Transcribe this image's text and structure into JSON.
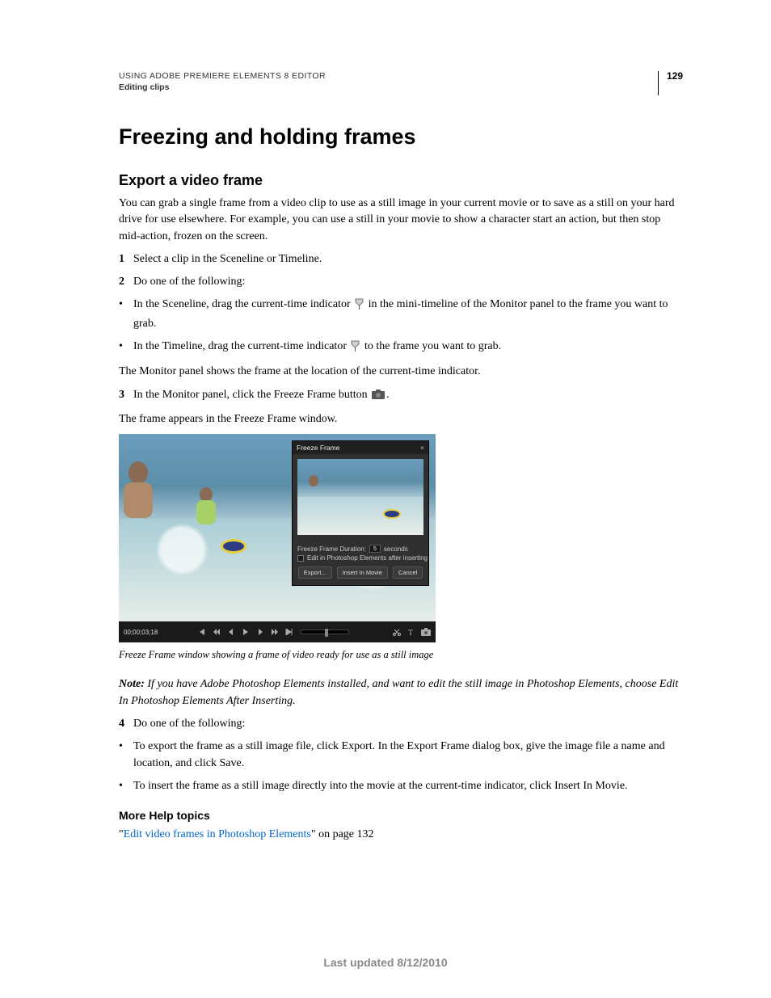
{
  "header": {
    "doc_title": "USING ADOBE PREMIERE ELEMENTS 8 EDITOR",
    "section": "Editing clips",
    "page_number": "129"
  },
  "h1": "Freezing and holding frames",
  "h2": "Export a video frame",
  "intro": "You can grab a single frame from a video clip to use as a still image in your current movie or to save as a still on your hard drive for use elsewhere. For example, you can use a still in your movie to show a character start an action, but then stop mid-action, frozen on the screen.",
  "steps": {
    "s1": "Select a clip in the Sceneline or Timeline.",
    "s2": "Do one of the following:",
    "s2a_pre": "In the Sceneline, drag the current-time indicator",
    "s2a_post": "in the mini-timeline of the Monitor panel to the frame you want to grab.",
    "s2b_pre": "In the Timeline, drag the current-time indicator",
    "s2b_post": "to the frame you want to grab.",
    "after2": "The Monitor panel shows the frame at the location of the current-time indicator.",
    "s3_pre": "In the Monitor panel, click the Freeze Frame button",
    "s3_post": ".",
    "after3": "The frame appears in the Freeze Frame window.",
    "s4": "Do one of the following:",
    "s4a": "To export the frame as a still image file, click Export. In the Export Frame dialog box, give the image file a name and location, and click Save.",
    "s4b": "To insert the frame as a still image directly into the movie at the current-time indicator, click Insert In Movie."
  },
  "screenshot": {
    "dialog_title": "Freeze Frame",
    "duration_label": "Freeze Frame Duration:",
    "duration_value": "5",
    "duration_unit": "seconds",
    "edit_label": "Edit in Photoshop Elements after inserting",
    "btn_export": "Export...",
    "btn_insert": "Insert In Movie",
    "btn_cancel": "Cancel",
    "timecode": "00;00;03;18"
  },
  "caption": "Freeze Frame window showing a frame of video ready for use as a still image",
  "note": {
    "label": "Note:",
    "text": "If you have Adobe Photoshop Elements installed, and want to edit the still image in Photoshop Elements, choose Edit In Photoshop Elements After Inserting."
  },
  "more_help": {
    "heading": "More Help topics",
    "link_text": "Edit video frames in Photoshop Elements",
    "link_suffix": "\" on page 132",
    "link_prefix": "\""
  },
  "footer": "Last updated 8/12/2010"
}
